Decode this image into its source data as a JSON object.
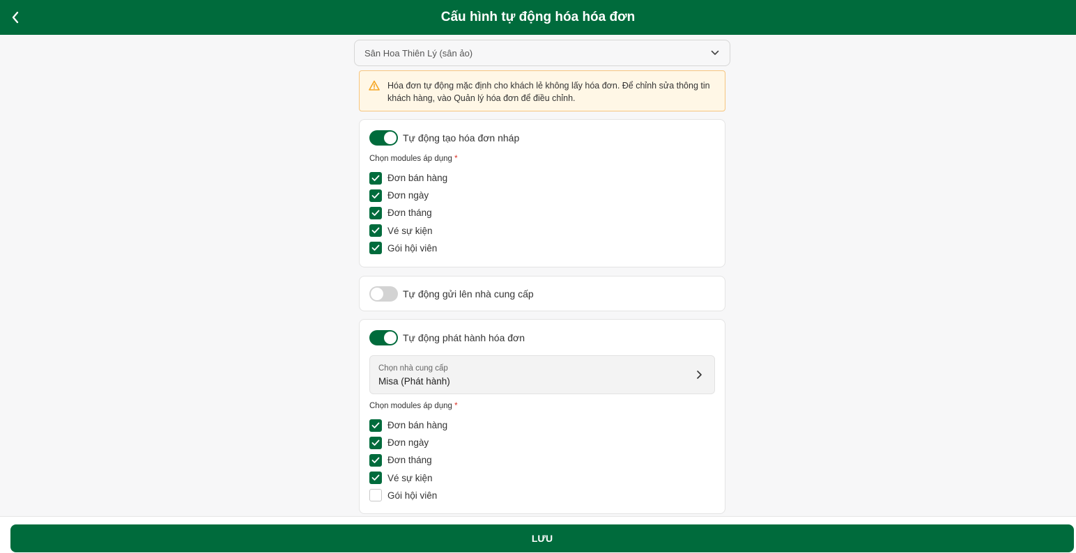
{
  "header": {
    "title": "Cấu hình tự động hóa hóa đơn",
    "back_icon": "chevron-left-icon"
  },
  "venue_select": {
    "value": "Sân Hoa Thiên Lý (sân ảo)",
    "icon": "chevron-down-icon"
  },
  "alert": {
    "icon": "warning-triangle-icon",
    "line1": "Hóa đơn tự động mặc định cho khách lẻ không lấy hóa đơn. Để chỉnh sửa thông tin",
    "line2": "khách hàng, vào Quản lý hóa đơn để điều chỉnh."
  },
  "draft": {
    "label": "Tự động tạo hóa đơn nháp",
    "enabled": true,
    "modules_label": "Chọn modules áp dụng",
    "required_mark": "*",
    "modules": [
      {
        "label": "Đơn bán hàng",
        "checked": true
      },
      {
        "label": "Đơn ngày",
        "checked": true
      },
      {
        "label": "Đơn tháng",
        "checked": true
      },
      {
        "label": "Vé sự kiện",
        "checked": true
      },
      {
        "label": "Gói hội viên",
        "checked": true
      }
    ]
  },
  "send": {
    "label": "Tự động gửi lên nhà cung cấp",
    "enabled": false
  },
  "issue": {
    "label": "Tự động phát hành hóa đơn",
    "enabled": true,
    "provider_caption": "Chọn nhà cung cấp",
    "provider_value": "Misa (Phát hành)",
    "provider_icon": "chevron-right-icon",
    "modules_label": "Chọn modules áp dụng",
    "required_mark": "*",
    "modules": [
      {
        "label": "Đơn bán hàng",
        "checked": true
      },
      {
        "label": "Đơn ngày",
        "checked": true
      },
      {
        "label": "Đơn tháng",
        "checked": true
      },
      {
        "label": "Vé sự kiện",
        "checked": true
      },
      {
        "label": "Gói hội viên",
        "checked": false
      }
    ]
  },
  "footer": {
    "save_label": "LƯU"
  },
  "colors": {
    "primary": "#006b3c",
    "alert_bg": "#fff7e6",
    "alert_border": "#f6c57f",
    "warning": "#f5a623"
  }
}
